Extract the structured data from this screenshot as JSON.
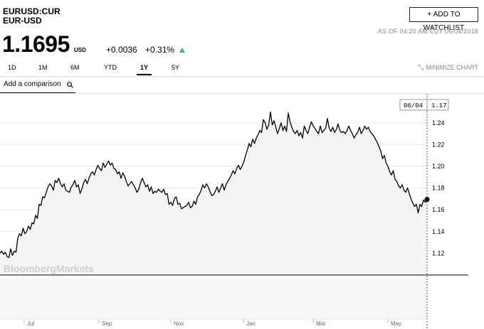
{
  "header": {
    "symbol": "EURUSD:CUR",
    "pair": "EUR-USD",
    "watchlist_label": "+ ADD TO WATCHLIST",
    "as_of": "AS OF 04:20 AM EDT 06/04/2018"
  },
  "quote": {
    "price": "1.1695",
    "currency": "USD",
    "change": "+0.0036",
    "change_pct": "+0.31%",
    "up_color": "#3ab583"
  },
  "ranges": {
    "items": [
      "1D",
      "1M",
      "6M",
      "YTD",
      "1Y",
      "5Y"
    ],
    "active": "1Y"
  },
  "controls": {
    "minimize_label": "MINIMIZE CHART",
    "comparison_placeholder": "Add a comparison"
  },
  "watermark": "BloombergMarkets",
  "colors": {
    "line": "#000000",
    "fill": "#f4f4f4",
    "grid": "#e6e6e6"
  },
  "chart_data": {
    "type": "area",
    "title": "",
    "xlabel": "",
    "ylabel": "",
    "x_tick_labels": [
      "Jul",
      "Sep",
      "Nov",
      "Jan",
      "Mar",
      "May"
    ],
    "y_tick_labels": [
      "1.12",
      "1.14",
      "1.16",
      "1.18",
      "1.20",
      "1.22",
      "1.24"
    ],
    "ylim": [
      1.1,
      1.2667
    ],
    "last_date": "06/04",
    "last_value": "1.17",
    "series": [
      {
        "values": [
          1.12,
          1.122,
          1.119,
          1.121,
          1.117,
          1.116,
          1.124,
          1.118,
          1.122,
          1.121,
          1.134,
          1.138,
          1.136,
          1.143,
          1.138,
          1.14,
          1.145,
          1.142,
          1.148,
          1.147,
          1.155,
          1.152,
          1.165,
          1.164,
          1.172,
          1.171,
          1.176,
          1.181,
          1.184,
          1.182,
          1.178,
          1.187,
          1.185,
          1.189,
          1.184,
          1.181,
          1.184,
          1.178,
          1.177,
          1.176,
          1.181,
          1.183,
          1.187,
          1.181,
          1.183,
          1.175,
          1.179,
          1.185,
          1.188,
          1.184,
          1.189,
          1.193,
          1.195,
          1.192,
          1.197,
          1.201,
          1.198,
          1.196,
          1.203,
          1.199,
          1.202,
          1.205,
          1.201,
          1.203,
          1.198,
          1.197,
          1.193,
          1.195,
          1.189,
          1.194,
          1.191,
          1.186,
          1.182,
          1.184,
          1.186,
          1.183,
          1.18,
          1.176,
          1.179,
          1.185,
          1.189,
          1.185,
          1.181,
          1.183,
          1.177,
          1.181,
          1.175,
          1.177,
          1.176,
          1.179,
          1.177,
          1.176,
          1.179,
          1.174,
          1.175,
          1.165,
          1.167,
          1.164,
          1.17,
          1.172,
          1.165,
          1.166,
          1.161,
          1.162,
          1.163,
          1.164,
          1.167,
          1.162,
          1.163,
          1.168,
          1.165,
          1.172,
          1.174,
          1.178,
          1.183,
          1.18,
          1.184,
          1.181,
          1.177,
          1.173,
          1.174,
          1.177,
          1.181,
          1.176,
          1.18,
          1.184,
          1.178,
          1.183,
          1.186,
          1.189,
          1.192,
          1.196,
          1.193,
          1.198,
          1.201,
          1.197,
          1.2,
          1.204,
          1.21,
          1.215,
          1.221,
          1.218,
          1.225,
          1.221,
          1.226,
          1.229,
          1.233,
          1.231,
          1.243,
          1.24,
          1.234,
          1.238,
          1.25,
          1.238,
          1.242,
          1.236,
          1.23,
          1.235,
          1.24,
          1.233,
          1.237,
          1.232,
          1.249,
          1.241,
          1.236,
          1.232,
          1.23,
          1.233,
          1.228,
          1.231,
          1.226,
          1.237,
          1.233,
          1.23,
          1.236,
          1.241,
          1.237,
          1.235,
          1.232,
          1.23,
          1.237,
          1.231,
          1.233,
          1.235,
          1.244,
          1.235,
          1.232,
          1.236,
          1.231,
          1.234,
          1.239,
          1.233,
          1.231,
          1.232,
          1.23,
          1.233,
          1.237,
          1.233,
          1.23,
          1.226,
          1.229,
          1.231,
          1.236,
          1.23,
          1.233,
          1.237,
          1.234,
          1.236,
          1.232,
          1.23,
          1.228,
          1.225,
          1.222,
          1.218,
          1.214,
          1.207,
          1.21,
          1.203,
          1.2,
          1.195,
          1.192,
          1.196,
          1.188,
          1.186,
          1.182,
          1.18,
          1.183,
          1.178,
          1.176,
          1.18,
          1.175,
          1.17,
          1.166,
          1.163,
          1.165,
          1.157,
          1.165,
          1.163,
          1.169,
          1.167,
          1.1695
        ]
      }
    ]
  }
}
